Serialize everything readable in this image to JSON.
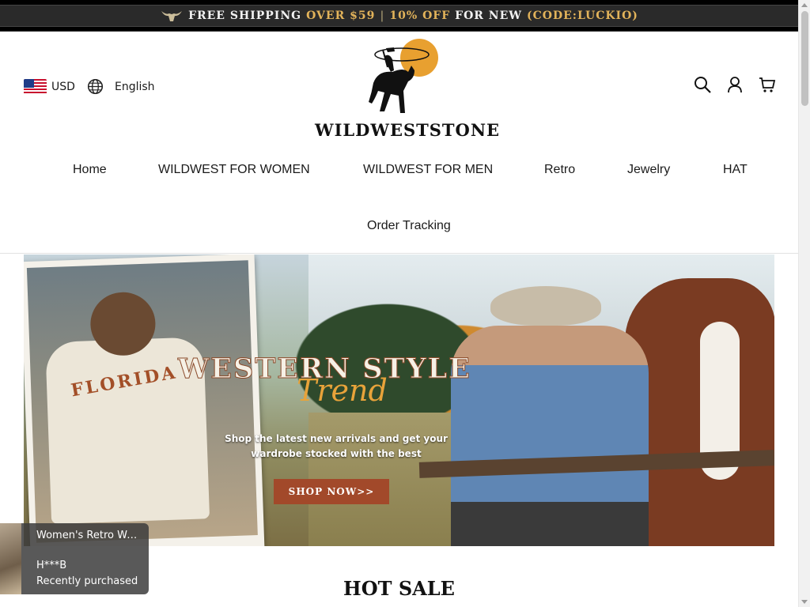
{
  "announcement": {
    "free_shipping": "FREE SHIPPING",
    "over": "OVER $59",
    "divider": "|",
    "off": "10% OFF",
    "for_new": "FOR NEW",
    "code": "(CODE:LUCKIO)"
  },
  "header": {
    "currency": "USD",
    "language": "English",
    "brand": "WILDWESTSTONE",
    "icons": [
      "search-icon",
      "account-icon",
      "cart-icon"
    ]
  },
  "nav": {
    "items": [
      "Home",
      "WILDWEST FOR WOMEN",
      "WILDWEST FOR MEN",
      "Retro",
      "Jewelry",
      "HAT",
      "Order Tracking"
    ]
  },
  "hero": {
    "title": "WESTERN STYLE",
    "script": "Trend",
    "subtitle": "Shop the latest new arrivals and get your wardrobe stocked with the best",
    "cta": "SHOP NOW>>",
    "shirt_text": "FLORIDA"
  },
  "toast": {
    "product": "Women's Retro Wes...",
    "customer": "H***B",
    "action": "Recently purchased"
  },
  "section": {
    "hot_sale": "HOT SALE"
  },
  "colors": {
    "accent_gold": "#e2b35a",
    "cta": "#a2492a"
  }
}
